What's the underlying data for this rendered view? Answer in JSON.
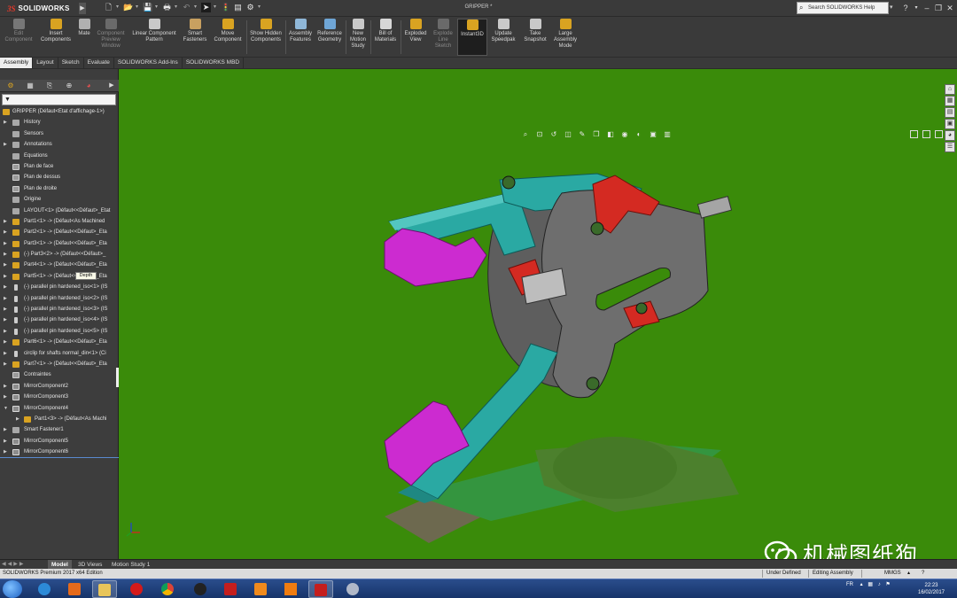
{
  "app": {
    "logo_ds": "3S",
    "logo_text": "SOLIDWORKS",
    "doc_title": "GRIPPER *"
  },
  "search": {
    "placeholder": "Search SOLIDWORKS Help"
  },
  "ribbon": {
    "buttons": [
      {
        "label": "Edit Component",
        "state": "disabled"
      },
      {
        "label": "Insert Components",
        "state": "enabled"
      },
      {
        "label": "Mate",
        "state": "enabled"
      },
      {
        "label": "Component Preview Window",
        "state": "disabled"
      },
      {
        "label": "Linear Component Pattern",
        "state": "enabled"
      },
      {
        "label": "Smart Fasteners",
        "state": "enabled"
      },
      {
        "label": "Move Component",
        "state": "enabled"
      },
      {
        "label": "Show Hidden Components",
        "state": "enabled"
      },
      {
        "label": "Assembly Features",
        "state": "enabled"
      },
      {
        "label": "Reference Geometry",
        "state": "enabled"
      },
      {
        "label": "New Motion Study",
        "state": "enabled"
      },
      {
        "label": "Bill of Materials",
        "state": "enabled"
      },
      {
        "label": "Exploded View",
        "state": "enabled"
      },
      {
        "label": "Explode Line Sketch",
        "state": "disabled"
      },
      {
        "label": "Instant3D",
        "state": "active"
      },
      {
        "label": "Update Speedpak",
        "state": "enabled"
      },
      {
        "label": "Take Snapshot",
        "state": "enabled"
      },
      {
        "label": "Large Assembly Mode",
        "state": "enabled"
      }
    ]
  },
  "command_tabs": [
    "Assembly",
    "Layout",
    "Sketch",
    "Evaluate",
    "SOLIDWORKS Add-Ins",
    "SOLIDWORKS MBD"
  ],
  "active_command_tab": "Assembly",
  "feature_tree": {
    "filter_icon": "filter-icon",
    "root": "GRIPPER  (Défaut<Etat d'affichage-1>)",
    "items": [
      {
        "label": "History",
        "icon": "history",
        "arrow": true
      },
      {
        "label": "Sensors",
        "icon": "sensor",
        "arrow": false
      },
      {
        "label": "Annotations",
        "icon": "annotation",
        "arrow": true
      },
      {
        "label": "Equations",
        "icon": "equation",
        "arrow": false
      },
      {
        "label": "Plan de face",
        "icon": "plane",
        "arrow": false
      },
      {
        "label": "Plan de dessus",
        "icon": "plane",
        "arrow": false
      },
      {
        "label": "Plan de droite",
        "icon": "plane",
        "arrow": false
      },
      {
        "label": "Origine",
        "icon": "origin",
        "arrow": false
      },
      {
        "label": "LAYOUT<1> (Défaut<<Défaut>_Etat",
        "icon": "gray",
        "arrow": false
      },
      {
        "label": "Part1<1> -> (Défaut<As Machined",
        "icon": "gear",
        "arrow": true
      },
      {
        "label": "Part2<1> -> (Défaut<<Défaut>_Eta",
        "icon": "gear",
        "arrow": true
      },
      {
        "label": "Part3<1> -> (Défaut<<Défaut>_Eta",
        "icon": "gear",
        "arrow": true
      },
      {
        "label": "(-) Part3<2> -> (Défaut<<Défaut>_",
        "icon": "gear",
        "arrow": true
      },
      {
        "label": "Part4<1> -> (Défaut<<Défaut>_Eta",
        "icon": "gear",
        "arrow": true
      },
      {
        "label": "Part5<1> -> (Défaut<<Défaut>_Eta",
        "icon": "gear",
        "arrow": true
      },
      {
        "label": "(-) parallel pin hardened_iso<1> (IS",
        "icon": "pin",
        "arrow": true
      },
      {
        "label": "(-) parallel pin hardened_iso<2> (IS",
        "icon": "pin",
        "arrow": true
      },
      {
        "label": "(-) parallel pin hardened_iso<3> (IS",
        "icon": "pin",
        "arrow": true
      },
      {
        "label": "(-) parallel pin hardened_iso<4> (IS",
        "icon": "pin",
        "arrow": true
      },
      {
        "label": "(-) parallel pin hardened_iso<5> (IS",
        "icon": "pin",
        "arrow": true
      },
      {
        "label": "Part6<1> -> (Défaut<<Défaut>_Eta",
        "icon": "gear",
        "arrow": true
      },
      {
        "label": "circlip for shafts normal_din<1> (Ci",
        "icon": "pin",
        "arrow": true
      },
      {
        "label": "Part7<1> -> (Défaut<<Défaut>_Eta",
        "icon": "gear",
        "arrow": true
      },
      {
        "label": "Contraintes",
        "icon": "mates",
        "arrow": false
      },
      {
        "label": "MirrorComponent2",
        "icon": "mirror",
        "arrow": true
      },
      {
        "label": "MirrorComponent3",
        "icon": "mirror",
        "arrow": true
      },
      {
        "label": "MirrorComponent4",
        "icon": "mirror",
        "arrow": true,
        "expanded": true
      },
      {
        "label": "Part1<3> -> (Défaut<As Machi",
        "icon": "gear",
        "arrow": true,
        "sub": true
      },
      {
        "label": "Smart Fastener1",
        "icon": "fastener",
        "arrow": true
      },
      {
        "label": "MirrorComponent5",
        "icon": "mirror",
        "arrow": true
      },
      {
        "label": "MirrorComponent6",
        "icon": "mirror",
        "arrow": true
      }
    ],
    "tooltip": "Depth"
  },
  "bottom_tabs": [
    "Model",
    "3D Views",
    "Motion Study 1"
  ],
  "active_bottom_tab": "Model",
  "status": {
    "edition": "SOLIDWORKS Premium 2017 x64 Edition",
    "state": "Under Defined",
    "mode": "Editing Assembly",
    "units": "MMGS"
  },
  "taskbar": {
    "language": "FR",
    "time": "22:23",
    "date": "16/02/2017",
    "apps": [
      "windows-explorer",
      "internet-explorer",
      "media-player",
      "file-explorer",
      "opera",
      "chrome",
      "inkscape",
      "solidworks-2017",
      "orange-app",
      "vlc",
      "solidworks-2017-active",
      "settings"
    ]
  },
  "watermark": {
    "text": "机械图纸狗"
  },
  "colors": {
    "viewport_bg": "#3a8b0a",
    "part_teal": "#2aa9a3",
    "part_magenta": "#cc2bd0",
    "part_red": "#d42a22",
    "part_gray": "#6e6e6e"
  }
}
